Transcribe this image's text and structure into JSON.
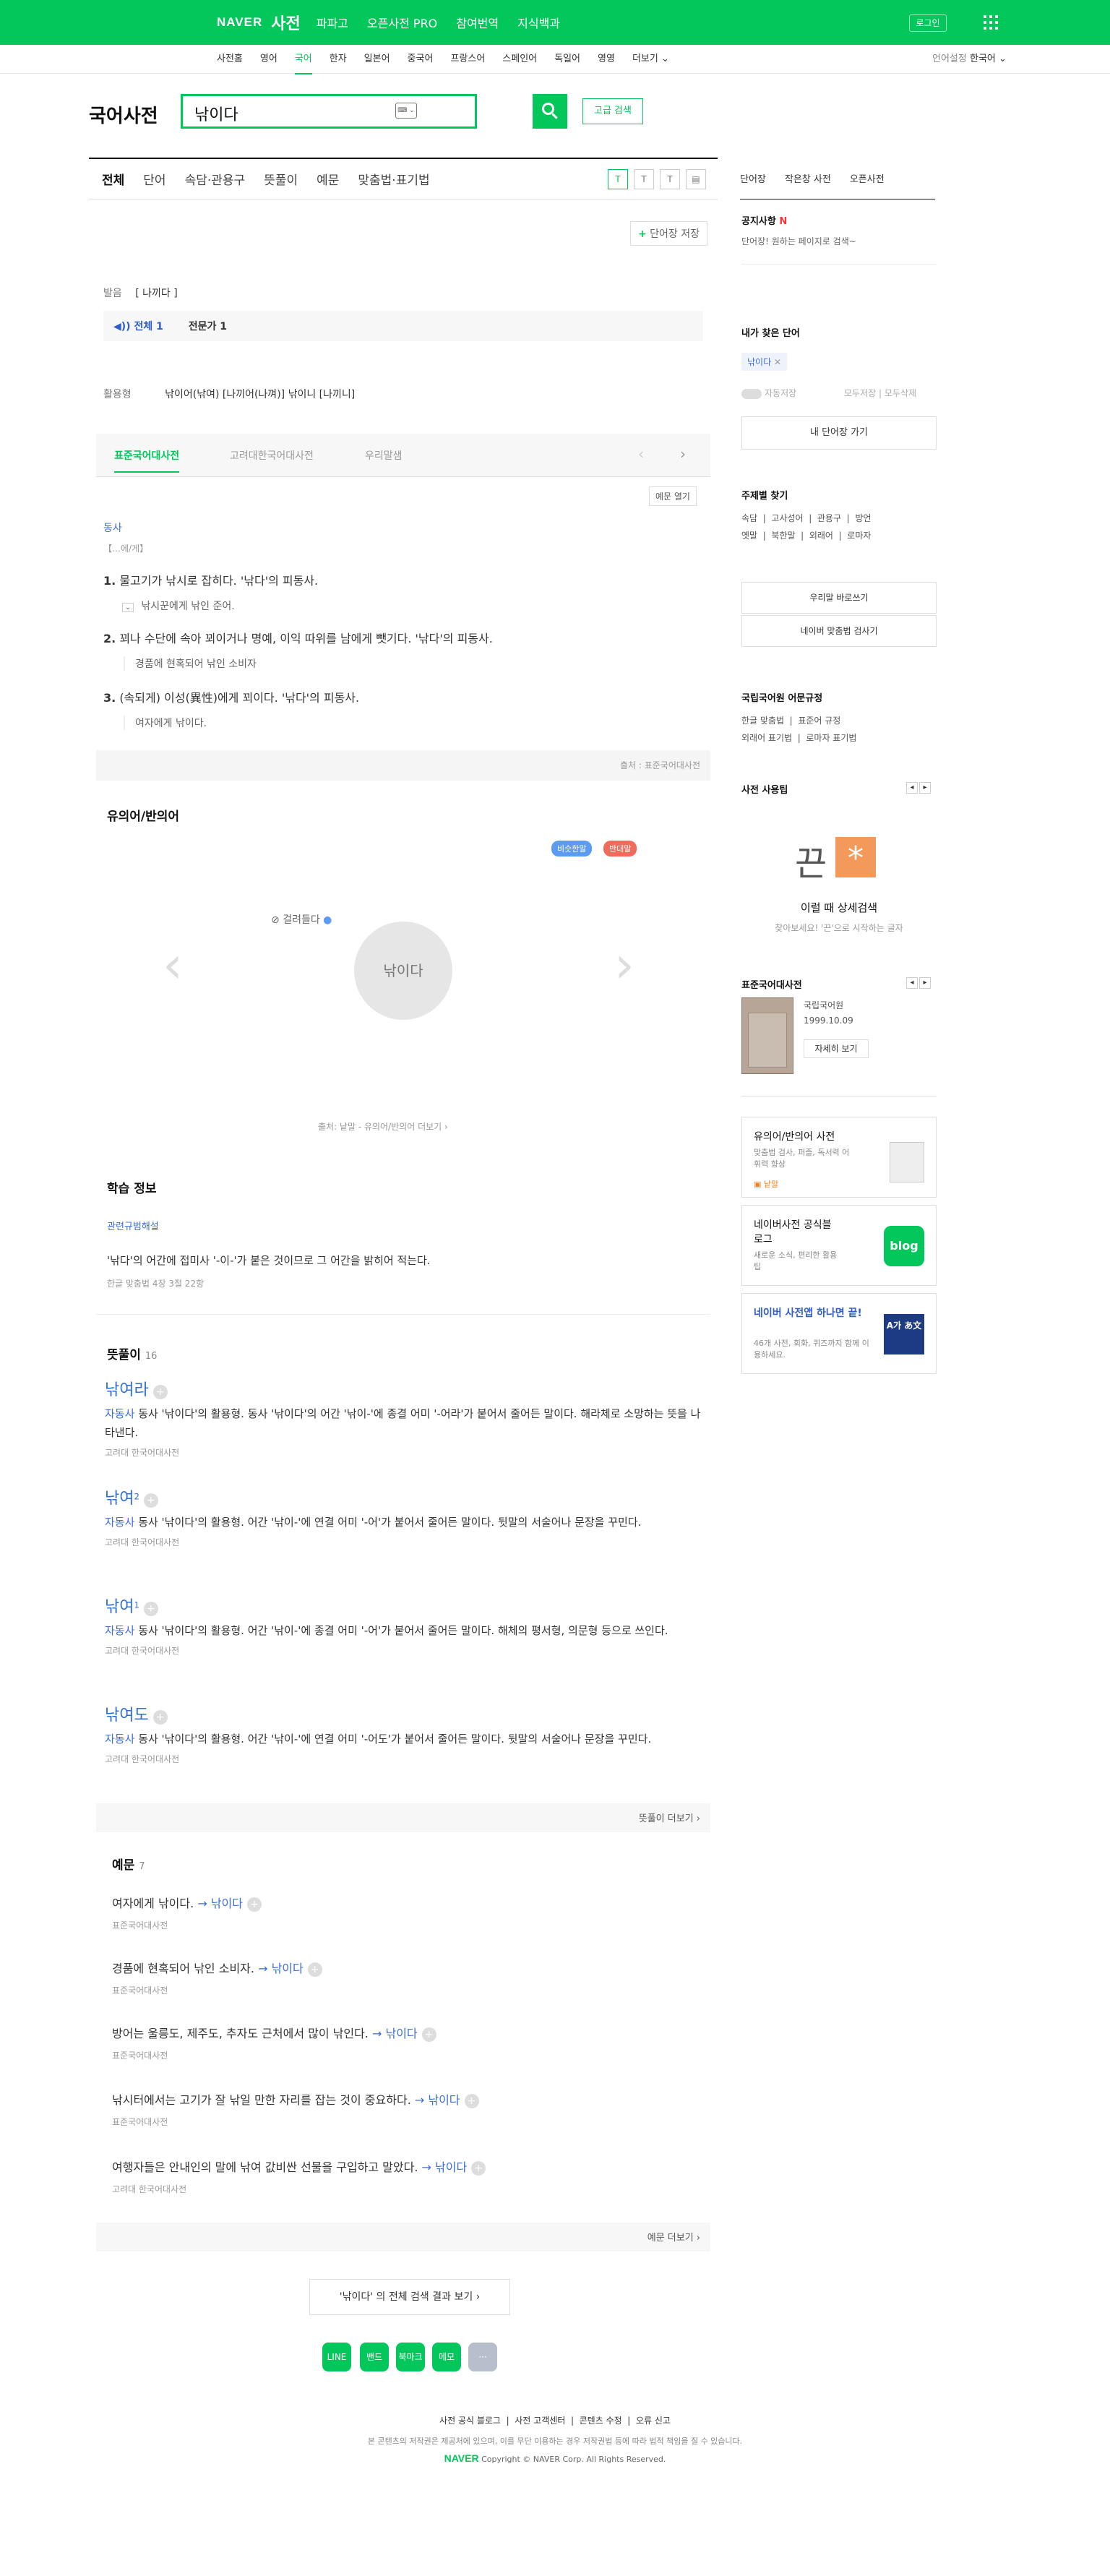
{
  "gnb": {
    "logo": "NAVER",
    "service": "사전",
    "menu": [
      "파파고",
      "오픈사전 PRO",
      "참여번역",
      "지식백과"
    ],
    "login": "로그인"
  },
  "lnb": {
    "items": [
      "사전홈",
      "영어",
      "국어",
      "한자",
      "일본어",
      "중국어",
      "프랑스어",
      "스페인어",
      "독일어",
      "영영",
      "더보기 ⌄"
    ],
    "lang_label": "언어설정",
    "lang": "한국어 ⌄"
  },
  "search": {
    "title": "국어사전",
    "query": "낚이다",
    "kbd": "⌨ ⌄",
    "adv": "고급 검색"
  },
  "tabs": [
    "전체",
    "단어",
    "속담·관용구",
    "뜻풀이",
    "예문",
    "맞춤법·표기법"
  ],
  "tools": [
    "T",
    "T",
    "T",
    "▤"
  ],
  "save": "단어장 저장",
  "entry": {
    "pron_label": "발음",
    "pron": "[ 나끼다 ]",
    "sound_all": "◀)) 전체 1",
    "sound_pro": "전문가 1",
    "conj_label": "활용형",
    "conj": "낚이어(낚여) [나끼어(나껴)] 낚이니 [나끼니]",
    "dict_tabs": [
      "표준국어대사전",
      "고려대한국어대사전",
      "우리말샘"
    ],
    "ex_open": "예문 열기",
    "pos": "동사",
    "pattern": "【…에/게】",
    "senses": [
      {
        "num": "1.",
        "text": "물고기가 낚시로 잡히다. '낚다'의 피동사.",
        "ex": "낚시꾼에게 낚인 준어."
      },
      {
        "num": "2.",
        "text": "꾀나 수단에 속아 꾀이거나 명예, 이익 따위를 남에게 뺏기다. '낚다'의 피동사.",
        "ex": "경품에 현혹되어 낚인 소비자"
      },
      {
        "num": "3.",
        "text": "(속되게) 이성(異性)에게 꾀이다. '낚다'의 피동사.",
        "ex": "여자에게 낚이다."
      }
    ],
    "source": "출처 : 표준국어대사전"
  },
  "syn": {
    "title": "유의어/반의어",
    "badges": [
      "비슷한말",
      "반대말"
    ],
    "link": "걸려들다",
    "center": "낚이다",
    "source": "출처: 낱말 - 유의어/반의어 더보기 ›"
  },
  "study": {
    "title": "학습 정보",
    "sub": "관련규범해설",
    "text": "'낚다'의 어간에 접미사 '-이-'가 붙은 것이므로 그 어간을 밝히어 적는다.",
    "src": "한글 맞춤법 4장 3절 22항"
  },
  "meanings": {
    "title": "뜻풀이",
    "count": "16",
    "items": [
      {
        "word": "낚여라",
        "sup": "",
        "pos": "자동사",
        "text": "동사 '낚이다'의 활용형. 동사 '낚이다'의 어간 '낚이-'에 종결 어미 '-어라'가 붙어서 줄어든 말이다. 해라체로 소망하는 뜻을 나타낸다.",
        "src": "고려대 한국어대사전"
      },
      {
        "word": "낚여",
        "sup": "2",
        "pos": "자동사",
        "text": "동사 '낚이다'의 활용형. 어간 '낚이-'에 연결 어미 '-어'가 붙어서 줄어든 말이다. 뒷말의 서술어나 문장을 꾸민다.",
        "src": "고려대 한국어대사전"
      },
      {
        "word": "낚여",
        "sup": "1",
        "pos": "자동사",
        "text": "동사 '낚이다'의 활용형. 어간 '낚이-'에 종결 어미 '-어'가 붙어서 줄어든 말이다. 해체의 평서형, 의문형 등으로 쓰인다.",
        "src": "고려대 한국어대사전"
      },
      {
        "word": "낚여도",
        "sup": "",
        "pos": "자동사",
        "text": "동사 '낚이다'의 활용형. 어간 '낚이-'에 연결 어미 '-어도'가 붙어서 줄어든 말이다. 뒷말의 서술어나 문장을 꾸민다.",
        "src": "고려대 한국어대사전"
      }
    ],
    "more": "뜻풀이 더보기 ›"
  },
  "examples": {
    "title": "예문",
    "count": "7",
    "items": [
      {
        "text": "여자에게 낚이다.",
        "link": "→ 낚이다",
        "src": "표준국어대사전"
      },
      {
        "text": "경품에 현혹되어 낚인 소비자.",
        "link": "→ 낚이다",
        "src": "표준국어대사전"
      },
      {
        "text": "방어는 울릉도, 제주도, 추자도 근처에서 많이 낚인다.",
        "link": "→ 낚이다",
        "src": "표준국어대사전"
      },
      {
        "text": "낚시터에서는 고기가 잘 낚일 만한 자리를 잡는 것이 중요하다.",
        "link": "→ 낚이다",
        "src": "표준국어대사전"
      },
      {
        "text": "여행자들은 안내인의 말에 낚여 값비싼 선물을 구입하고 말았다.",
        "link": "→ 낚이다",
        "src": "고려대 한국어대사전"
      }
    ],
    "more": "예문 더보기 ›"
  },
  "fullsearch": "'낚이다' 의 전체 검색 결과 보기 ›",
  "side": {
    "tabs": [
      "단어장",
      "작은창 사전",
      "오픈사전"
    ],
    "notice_title": "공지사항",
    "notice_new": "N",
    "notice": "단어장! 원하는 페이지로 검색~",
    "history_title": "내가 찾은 단어",
    "history_word": "낚이다",
    "toggle": "자동저장",
    "hist_all": "모두저장",
    "hist_del": "모두삭제",
    "my_btn": "내 단어장 가기",
    "topic_title": "주제별 찾기",
    "topics": [
      "속담",
      "고사성어",
      "관용구",
      "방언",
      "옛말",
      "북한말",
      "외래어",
      "로마자"
    ],
    "link1": "우리말 바로쓰기",
    "link2": "네이버 맞춤법 검사기",
    "rule_title": "국립국어원 어문규정",
    "rules": [
      "한글 맞춤법",
      "표준어 규정",
      "외래어 표기법",
      "로마자 표기법"
    ],
    "tip_title": "사전 사용팁",
    "tip_char": "끈",
    "tip_star": "*",
    "tip_head": "이럴 때 상세검색",
    "tip_sub": "찾아보세요! '끈'으로 시작하는 글자",
    "book_title": "표준국어대사전",
    "book_pub": "국립국어원",
    "book_date": "1999.10.09",
    "book_btn": "자세히 보기",
    "ad1_title": "유의어/반의어 사전",
    "ad1_text": "맞춤법 검사, 퍼즐, 독서력 어휘력 향상",
    "ad1_brand": "낱말",
    "ad2_title": "네이버사전 공식블로그",
    "ad2_text": "새로운 소식, 편리한 활용팁",
    "ad2_icon": "blog",
    "ad3_title": "네이버 사전앱 하나면 끝!",
    "ad3_text": "46개 사전, 회화, 퀴즈까지 함께 이용하세요.",
    "ad3_icon": "A가 あ文"
  },
  "share": [
    "LINE",
    "밴드",
    "북마크",
    "메모",
    "···"
  ],
  "footer": {
    "links": [
      "사전 공식 블로그",
      "사전 고객센터",
      "콘텐츠 수정",
      "오류 신고"
    ],
    "notice": "본 콘텐츠의 저작권은 제공처에 있으며, 이를 무단 이용하는 경우 저작권법 등에 따라 법적 책임을 질 수 있습니다.",
    "logo": "NAVER",
    "copy": "Copyright © NAVER Corp. All Rights Reserved."
  }
}
